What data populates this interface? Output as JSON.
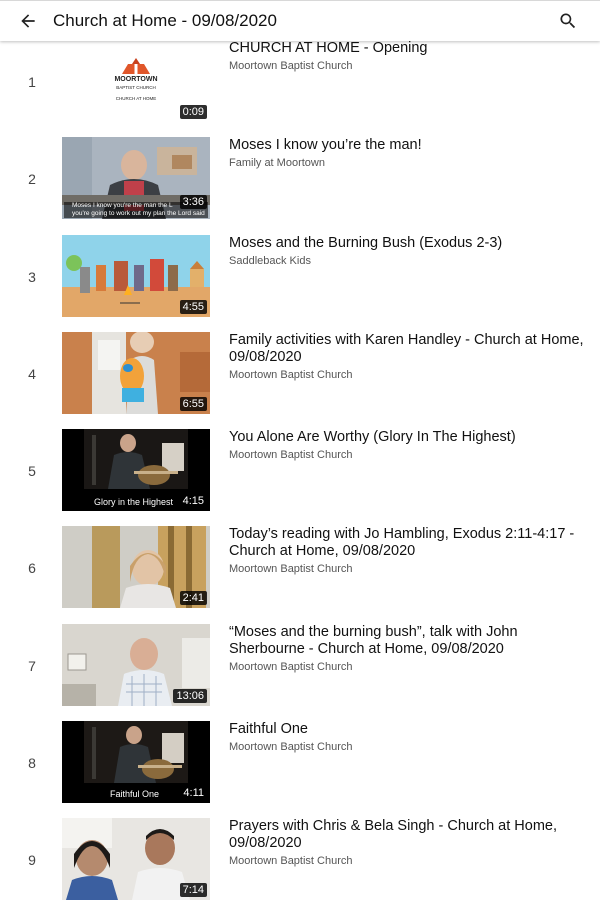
{
  "header": {
    "title": "Church at Home - 09/08/2020",
    "back_icon": "arrow-left-icon",
    "search_icon": "search-icon"
  },
  "logo": {
    "line1": "MOORTOWN",
    "line2": "BAPTIST CHURCH",
    "line3": "CHURCH AT HOME"
  },
  "playlist": [
    {
      "index": "1",
      "title": "CHURCH AT HOME - Opening",
      "channel": "Moortown Baptist Church",
      "duration": "0:09"
    },
    {
      "index": "2",
      "title": "Moses I know you’re the man!",
      "channel": "Family at Moortown",
      "duration": "3:36",
      "subtitle1": "Moses I know you're the man the L",
      "subtitle2": "you're going to work out my plan the Lord said"
    },
    {
      "index": "3",
      "title": "Moses and the Burning Bush (Exodus 2-3)",
      "channel": "Saddleback Kids",
      "duration": "4:55"
    },
    {
      "index": "4",
      "title": "Family activities with Karen Handley - Church at Home, 09/08/2020",
      "channel": "Moortown Baptist Church",
      "duration": "6:55"
    },
    {
      "index": "5",
      "title": "You Alone Are Worthy (Glory In The Highest)",
      "channel": "Moortown Baptist Church",
      "duration": "4:15",
      "caption": "Glory in the Highest"
    },
    {
      "index": "6",
      "title": "Today’s reading with Jo Hambling, Exodus 2:11-4:17 - Church at Home, 09/08/2020",
      "channel": "Moortown Baptist Church",
      "duration": "2:41"
    },
    {
      "index": "7",
      "title": "“Moses and the burning bush”, talk with John Sherbourne - Church at Home, 09/08/2020",
      "channel": "Moortown Baptist Church",
      "duration": "13:06"
    },
    {
      "index": "8",
      "title": "Faithful One",
      "channel": "Moortown Baptist Church",
      "duration": "4:11",
      "caption": "Faithful One"
    },
    {
      "index": "9",
      "title": "Prayers with Chris & Bela Singh - Church at Home, 09/08/2020",
      "channel": "Moortown Baptist Church",
      "duration": "7:14"
    }
  ]
}
